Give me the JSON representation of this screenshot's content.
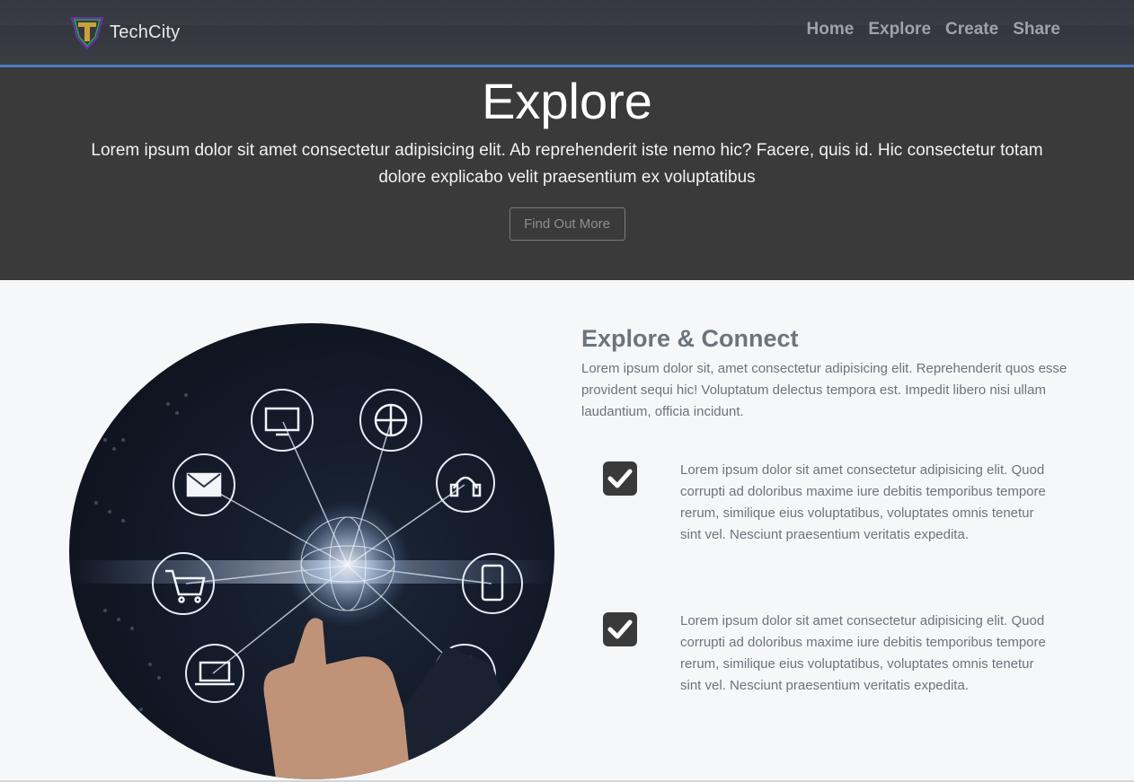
{
  "navbar": {
    "brand": "TechCity",
    "links": [
      "Home",
      "Explore",
      "Create",
      "Share"
    ]
  },
  "hero": {
    "title": "Explore",
    "text": "Lorem ipsum dolor sit amet consectetur adipisicing elit. Ab reprehenderit iste nemo hic? Facere, quis id. Hic consectetur totam dolore explicabo velit praesentium ex voluptatibus",
    "button": "Find Out More"
  },
  "section": {
    "title": "Explore & Connect",
    "text": "Lorem ipsum dolor sit, amet consectetur adipisicing elit. Reprehenderit quos esse provident sequi hic! Voluptatum delectus tempora est. Impedit libero nisi ullam laudantium, officia incidunt.",
    "features": [
      {
        "icon": "check-square-icon",
        "text": "Lorem ipsum dolor sit amet consectetur adipisicing elit. Quod corrupti ad doloribus maxime iure debitis temporibus tempore rerum, similique eius voluptatibus, voluptates omnis tenetur sint vel. Nesciunt praesentium veritatis expedita."
      },
      {
        "icon": "check-square-icon",
        "text": "Lorem ipsum dolor sit amet consectetur adipisicing elit. Quod corrupti ad doloribus maxime iure debitis temporibus tempore rerum, similique eius voluptatibus, voluptates omnis tenetur sint vel. Nesciunt praesentium veritatis expedita."
      }
    ]
  },
  "colors": {
    "accent": "#4a7bc8",
    "hero_bg": "#3a3a3a",
    "page_bg": "#f6f7f9",
    "text_muted": "#6c747c"
  }
}
